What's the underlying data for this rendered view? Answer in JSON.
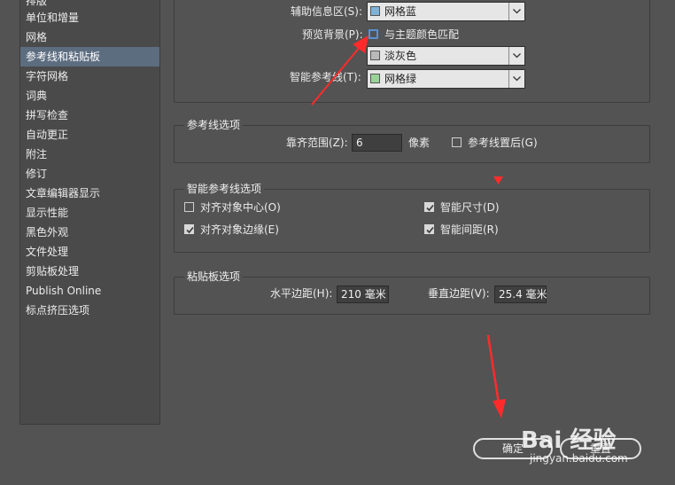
{
  "sidebar": {
    "items": [
      {
        "label": "排版"
      },
      {
        "label": "单位和增量"
      },
      {
        "label": "网格"
      },
      {
        "label": "参考线和粘贴板",
        "selected": true
      },
      {
        "label": "字符网格"
      },
      {
        "label": "词典"
      },
      {
        "label": "拼写检查"
      },
      {
        "label": "自动更正"
      },
      {
        "label": "附注"
      },
      {
        "label": "修订"
      },
      {
        "label": "文章编辑器显示"
      },
      {
        "label": "显示性能"
      },
      {
        "label": "黑色外观"
      },
      {
        "label": "文件处理"
      },
      {
        "label": "剪贴板处理"
      },
      {
        "label": "Publish Online"
      },
      {
        "label": "标点挤压选项"
      }
    ]
  },
  "color_section": {
    "aux_info_label": "辅助信息区(S):",
    "aux_info_value": "网格蓝",
    "aux_info_color": "#7fb2d8",
    "preview_bg_label": "预览背景(P):",
    "match_theme_label": "与主题颜色匹配",
    "match_theme_checked": false,
    "preview_bg_value": "淡灰色",
    "preview_bg_color": "#b9b9b9",
    "smart_guide_label": "智能参考线(T):",
    "smart_guide_value": "网格绿",
    "smart_guide_color": "#9ad39a"
  },
  "guide_options": {
    "title": "参考线选项",
    "snap_label": "靠齐范围(Z):",
    "snap_value": "6",
    "snap_unit": "像素",
    "guides_back_label": "参考线置后(G)",
    "guides_back_checked": false
  },
  "smart_guide_options": {
    "title": "智能参考线选项",
    "align_center_label": "对齐对象中心(O)",
    "align_center_checked": false,
    "align_edge_label": "对齐对象边缘(E)",
    "align_edge_checked": true,
    "smart_dim_label": "智能尺寸(D)",
    "smart_dim_checked": true,
    "smart_spacing_label": "智能间距(R)",
    "smart_spacing_checked": true
  },
  "pasteboard_options": {
    "title": "粘贴板选项",
    "h_margin_label": "水平边距(H):",
    "h_margin_value": "210 毫米",
    "v_margin_label": "垂直边距(V):",
    "v_margin_value": "25.4 毫米"
  },
  "buttons": {
    "ok": "确定",
    "reset": "重置"
  },
  "watermark": {
    "brand": "Bai 经验",
    "url": "jingyan.baidu.com"
  },
  "colors": {
    "background": "#535353",
    "sidebar": "#4a4a4a",
    "selection": "#5d6d80",
    "annotation_arrow": "#ff2b2b"
  }
}
